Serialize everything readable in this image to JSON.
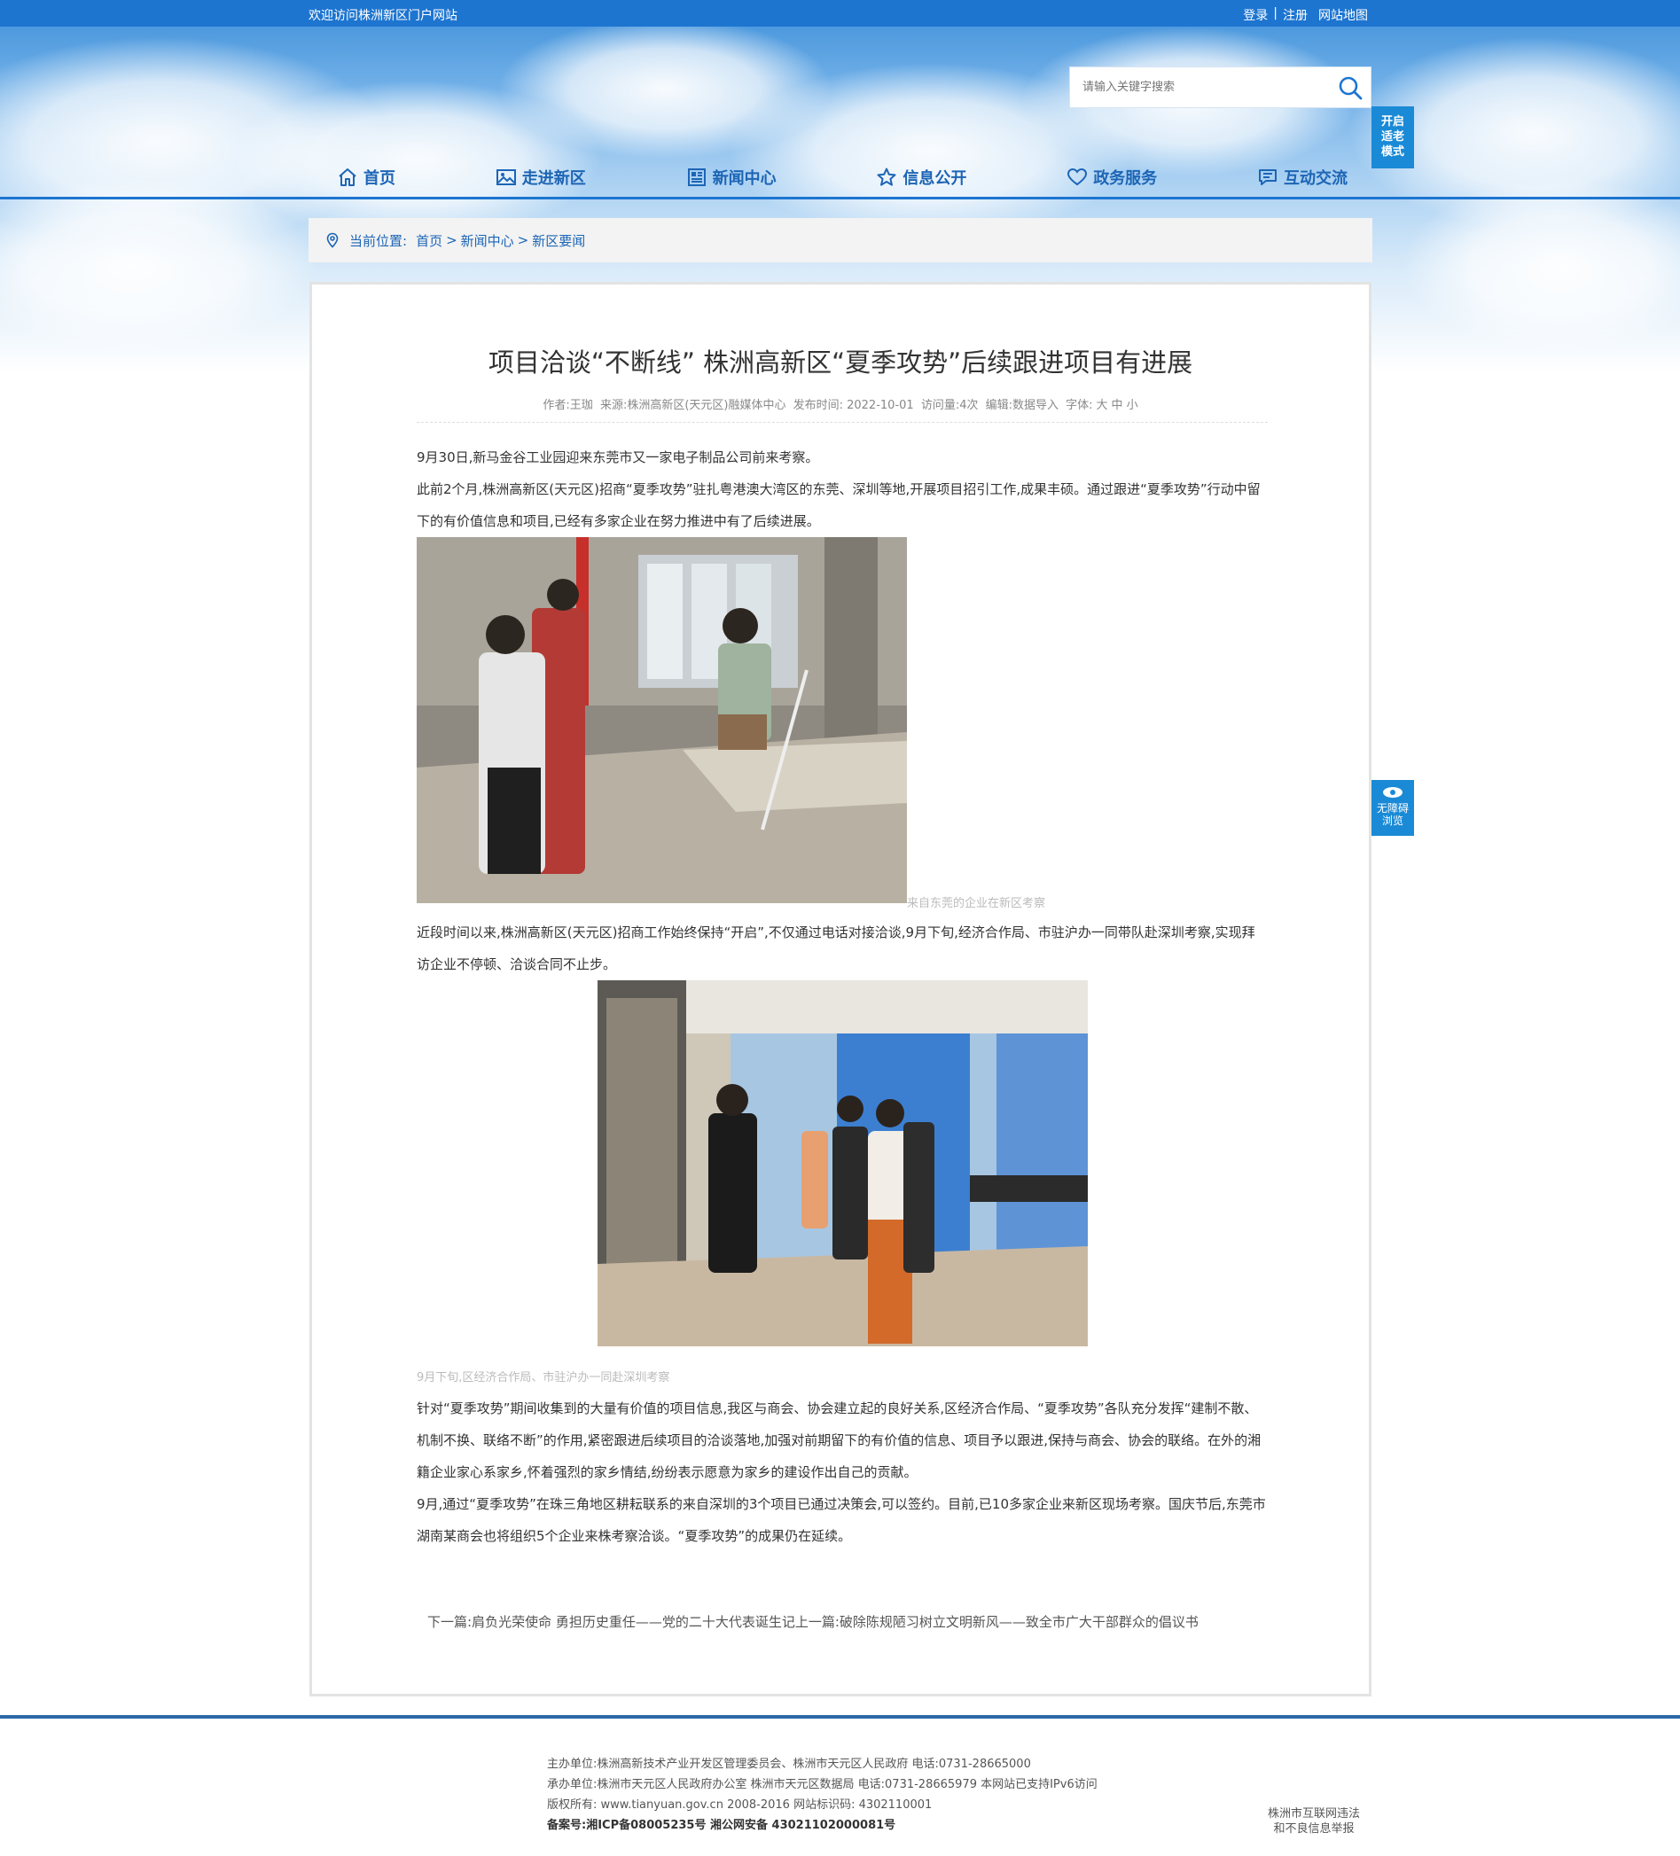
{
  "topbar": {
    "welcome": "欢迎访问株洲新区门户网站",
    "login": "登录",
    "sep": "|",
    "register": "注册",
    "sitemap": "网站地图"
  },
  "search": {
    "placeholder": "请输入关键字搜索",
    "icon": "search-icon"
  },
  "elder_mode": {
    "line1": "开启",
    "line2": "适老",
    "line3": "模式"
  },
  "nav": [
    {
      "label": "首页",
      "icon": "home-icon"
    },
    {
      "label": "走进新区",
      "icon": "picture-icon"
    },
    {
      "label": "新闻中心",
      "icon": "news-icon"
    },
    {
      "label": "信息公开",
      "icon": "star-icon"
    },
    {
      "label": "政务服务",
      "icon": "heart-icon"
    },
    {
      "label": "互动交流",
      "icon": "chat-icon"
    }
  ],
  "breadcrumb": {
    "label": "当前位置:",
    "items": [
      "首页",
      "新闻中心",
      "新区要闻"
    ],
    "sep": ">"
  },
  "article": {
    "title": "项目洽谈“不断线” 株洲高新区“夏季攻势”后续跟进项目有进展",
    "meta": {
      "author": "作者:王珈",
      "source": "来源:株洲高新区(天元区)融媒体中心",
      "date": "发布时间: 2022-10-01",
      "views": "访问量:4次",
      "editor": "编辑:数据导入",
      "font_label": "字体:",
      "font_large": "大",
      "font_medium": "中",
      "font_small": "小"
    },
    "paragraphs": [
      "9月30日,新马金谷工业园迎来东莞市又一家电子制品公司前来考察。",
      "此前2个月,株洲高新区(天元区)招商“夏季攻势”驻扎粤港澳大湾区的东莞、深圳等地,开展项目招引工作,成果丰硕。通过跟进“夏季攻势”行动中留下的有价值信息和项目,已经有多家企业在努力推进中有了后续进展。",
      "近段时间以来,株洲高新区(天元区)招商工作始终保持“开启”,不仅通过电话对接洽谈,9月下旬,经济合作局、市驻沪办一同带队赴深圳考察,实现拜访企业不停顿、洽谈合同不止步。",
      "针对“夏季攻势”期间收集到的大量有价值的项目信息,我区与商会、协会建立起的良好关系,区经济合作局、“夏季攻势”各队充分发挥“建制不散、机制不换、联络不断”的作用,紧密跟进后续项目的洽谈落地,加强对前期留下的有价值的信息、项目予以跟进,保持与商会、协会的联络。在外的湘籍企业家心系家乡,怀着强烈的家乡情结,纷纷表示愿意为家乡的建设作出自己的贡献。",
      "9月,通过“夏季攻势”在珠三角地区耕耘联系的来自深圳的3个项目已通过决策会,可以签约。目前,已10多家企业来新区现场考察。国庆节后,东莞市湖南某商会也将组织5个企业来株考察洽谈。“夏季攻势”的成果仍在延续。"
    ],
    "captions": [
      "来自东莞的企业在新区考察",
      "9月下旬,区经济合作局、市驻沪办一同赴深圳考察"
    ],
    "next_label": "下一篇:",
    "next_title": "肩负光荣使命 勇担历史重任——党的二十大代表诞生记",
    "prev_label": "上一篇:",
    "prev_title": "破除陈规陋习树立文明新风——致全市广大干部群众的倡议书"
  },
  "a11y": {
    "line1": "无障碍",
    "line2": "浏览",
    "icon": "eye-icon"
  },
  "footer": {
    "host": "主办单位:株洲高新技术产业开发区管理委员会、株洲市天元区人民政府 电话:0731-28665000",
    "organizer": "承办单位:株洲市天元区人民政府办公室 株洲市天元区数据局 电话:0731-28665979 本网站已支持IPv6访问",
    "copyright": "版权所有: www.tianyuan.gov.cn 2008-2016 网站标识码: 4302110001",
    "record": "备案号:湘ICP备08005235号    湘公网安备 43021102000081号",
    "report_line1": "株洲市互联网违法",
    "report_line2": "和不良信息举报"
  },
  "colors": {
    "topbar": "#1d75d0",
    "nav_text": "#1d65b5",
    "float_button": "#1a8ad6",
    "footer_line": "#2c69a8"
  }
}
